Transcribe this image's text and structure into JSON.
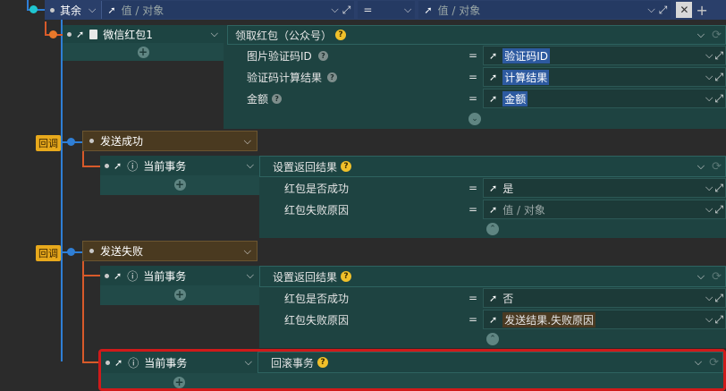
{
  "top": {
    "else_label": "其余",
    "left_placeholder": "值 / 对象",
    "operator": "=",
    "right_placeholder": "值 / 对象"
  },
  "wechat": {
    "object_label": "微信红包1",
    "action_label": "领取红包（公众号）",
    "params": [
      {
        "label": "图片验证码ID",
        "value": "验证码ID"
      },
      {
        "label": "验证码计算结果",
        "value": "计算结果"
      },
      {
        "label": "金额",
        "value": "金额"
      }
    ],
    "eq": "="
  },
  "callbacks": [
    {
      "tag": "回调",
      "event": "发送成功",
      "object_label": "当前事务",
      "action_label": "设置返回结果",
      "params": [
        {
          "label": "红包是否成功",
          "value": "是"
        },
        {
          "label": "红包失败原因",
          "value": "值 / 对象"
        }
      ]
    },
    {
      "tag": "回调",
      "event": "发送失败",
      "object_label": "当前事务",
      "action_label": "设置返回结果",
      "params": [
        {
          "label": "红包是否成功",
          "value": "否"
        },
        {
          "label": "红包失败原因",
          "value": "发送结果.失败原因"
        }
      ],
      "extra": {
        "object_label": "当前事务",
        "action_label": "回滚事务"
      }
    }
  ],
  "colors": {
    "accent_blue": "#2f7fd6",
    "accent_orange": "#e8a91c",
    "highlight_red": "#d01a1a",
    "panel_teal": "#214a48"
  }
}
